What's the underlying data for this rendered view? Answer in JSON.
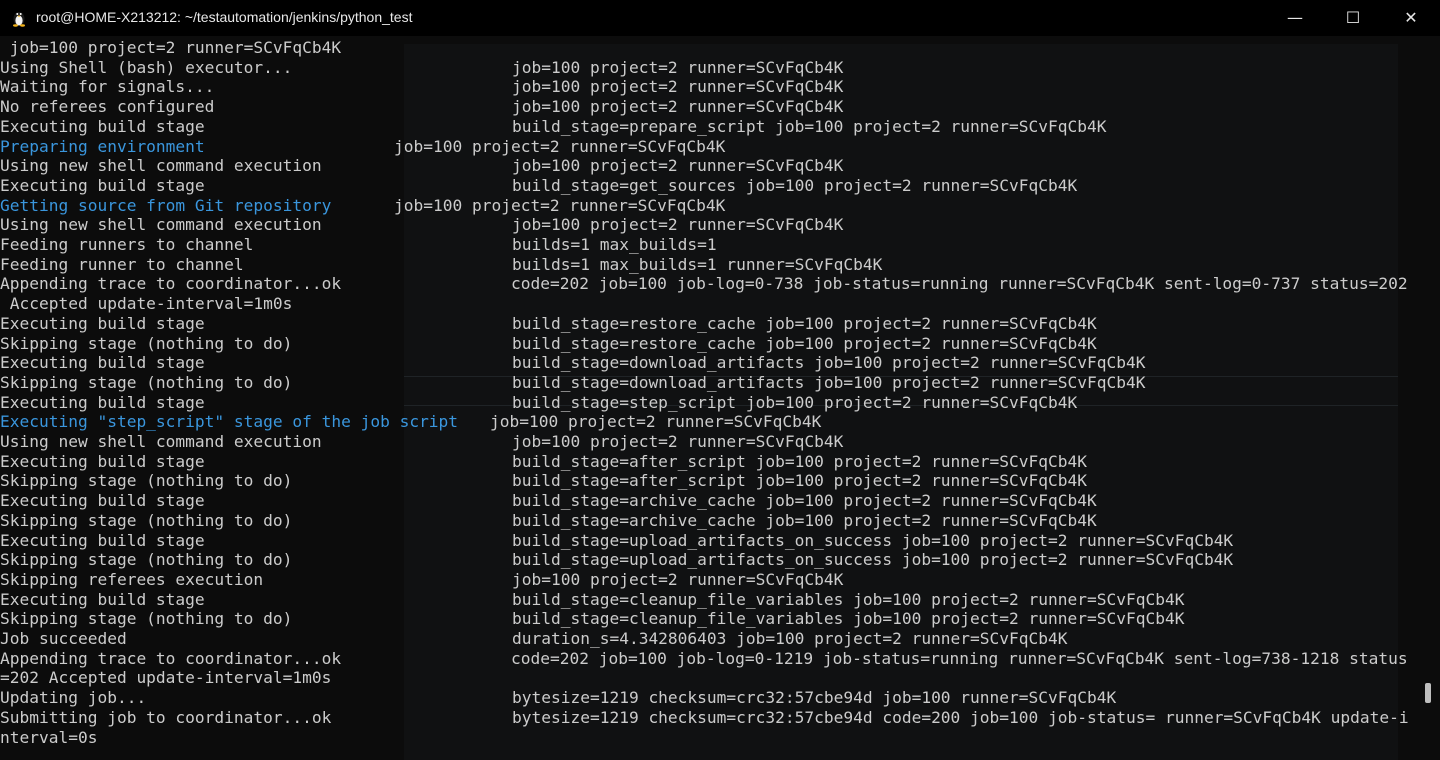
{
  "window": {
    "title": "root@HOME-X213212: ~/testautomation/jenkins/python_test",
    "icon": "tux-icon"
  },
  "controls": {
    "minimize": "—",
    "maximize": "☐",
    "close": "✕"
  },
  "colors": {
    "background": "#0c0c0c",
    "text": "#cccccc",
    "accent": "#3a96dd",
    "titlebar": "#000000"
  },
  "lines": [
    {
      "msg": " job=100 project=2 runner=SCvFqCb4K",
      "f": ""
    },
    {
      "msg": "Using Shell (bash) executor...",
      "f": "job=100 project=2 runner=SCvFqCb4K"
    },
    {
      "msg": "Waiting for signals...",
      "f": "job=100 project=2 runner=SCvFqCb4K"
    },
    {
      "msg": "No referees configured",
      "f": "job=100 project=2 runner=SCvFqCb4K"
    },
    {
      "msg": "Executing build stage",
      "f": "build_stage=prepare_script job=100 project=2 runner=SCvFqCb4K"
    },
    {
      "msg": "Preparing environment",
      "f": "job=100 project=2 runner=SCvFqCb4K",
      "cyan": true
    },
    {
      "msg": "Using new shell command execution",
      "f": "job=100 project=2 runner=SCvFqCb4K"
    },
    {
      "msg": "Executing build stage",
      "f": "build_stage=get_sources job=100 project=2 runner=SCvFqCb4K"
    },
    {
      "msg": "Getting source from Git repository",
      "f": "job=100 project=2 runner=SCvFqCb4K",
      "cyan": true
    },
    {
      "msg": "Using new shell command execution",
      "f": "job=100 project=2 runner=SCvFqCb4K"
    },
    {
      "msg": "Feeding runners to channel",
      "f": "builds=1 max_builds=1"
    },
    {
      "msg": "Feeding runner to channel",
      "f": "builds=1 max_builds=1 runner=SCvFqCb4K"
    },
    {
      "msg": "Appending trace to coordinator...ok",
      "f": "code=202 job=100 job-log=0-738 job-status=running runner=SCvFqCb4K sent-log=0-737 status=202"
    },
    {
      "msg": " Accepted update-interval=1m0s",
      "f": ""
    },
    {
      "msg": "Executing build stage",
      "f": "build_stage=restore_cache job=100 project=2 runner=SCvFqCb4K"
    },
    {
      "msg": "Skipping stage (nothing to do)",
      "f": "build_stage=restore_cache job=100 project=2 runner=SCvFqCb4K"
    },
    {
      "msg": "Executing build stage",
      "f": "build_stage=download_artifacts job=100 project=2 runner=SCvFqCb4K"
    },
    {
      "msg": "Skipping stage (nothing to do)",
      "f": "build_stage=download_artifacts job=100 project=2 runner=SCvFqCb4K"
    },
    {
      "msg": "Executing build stage",
      "f": "build_stage=step_script job=100 project=2 runner=SCvFqCb4K"
    },
    {
      "msg": "Executing \"step_script\" stage of the job script",
      "f": "job=100 project=2 runner=SCvFqCb4K",
      "cyan": true
    },
    {
      "msg": "Using new shell command execution",
      "f": "job=100 project=2 runner=SCvFqCb4K"
    },
    {
      "msg": "Executing build stage",
      "f": "build_stage=after_script job=100 project=2 runner=SCvFqCb4K"
    },
    {
      "msg": "Skipping stage (nothing to do)",
      "f": "build_stage=after_script job=100 project=2 runner=SCvFqCb4K"
    },
    {
      "msg": "Executing build stage",
      "f": "build_stage=archive_cache job=100 project=2 runner=SCvFqCb4K"
    },
    {
      "msg": "Skipping stage (nothing to do)",
      "f": "build_stage=archive_cache job=100 project=2 runner=SCvFqCb4K"
    },
    {
      "msg": "Executing build stage",
      "f": "build_stage=upload_artifacts_on_success job=100 project=2 runner=SCvFqCb4K"
    },
    {
      "msg": "Skipping stage (nothing to do)",
      "f": "build_stage=upload_artifacts_on_success job=100 project=2 runner=SCvFqCb4K"
    },
    {
      "msg": "Skipping referees execution",
      "f": "job=100 project=2 runner=SCvFqCb4K"
    },
    {
      "msg": "Executing build stage",
      "f": "build_stage=cleanup_file_variables job=100 project=2 runner=SCvFqCb4K"
    },
    {
      "msg": "Skipping stage (nothing to do)",
      "f": "build_stage=cleanup_file_variables job=100 project=2 runner=SCvFqCb4K"
    },
    {
      "msg": "Job succeeded",
      "f": "duration_s=4.342806403 job=100 project=2 runner=SCvFqCb4K"
    },
    {
      "msg": "Appending trace to coordinator...ok",
      "f": "code=202 job=100 job-log=0-1219 job-status=running runner=SCvFqCb4K sent-log=738-1218 status"
    },
    {
      "msg": "=202 Accepted update-interval=1m0s",
      "f": ""
    },
    {
      "msg": "Updating job...",
      "f": "bytesize=1219 checksum=crc32:57cbe94d job=100 runner=SCvFqCb4K"
    },
    {
      "msg": "Submitting job to coordinator...ok",
      "f": "bytesize=1219 checksum=crc32:57cbe94d code=200 job=100 job-status= runner=SCvFqCb4K update-i"
    },
    {
      "msg": "nterval=0s",
      "f": ""
    }
  ]
}
